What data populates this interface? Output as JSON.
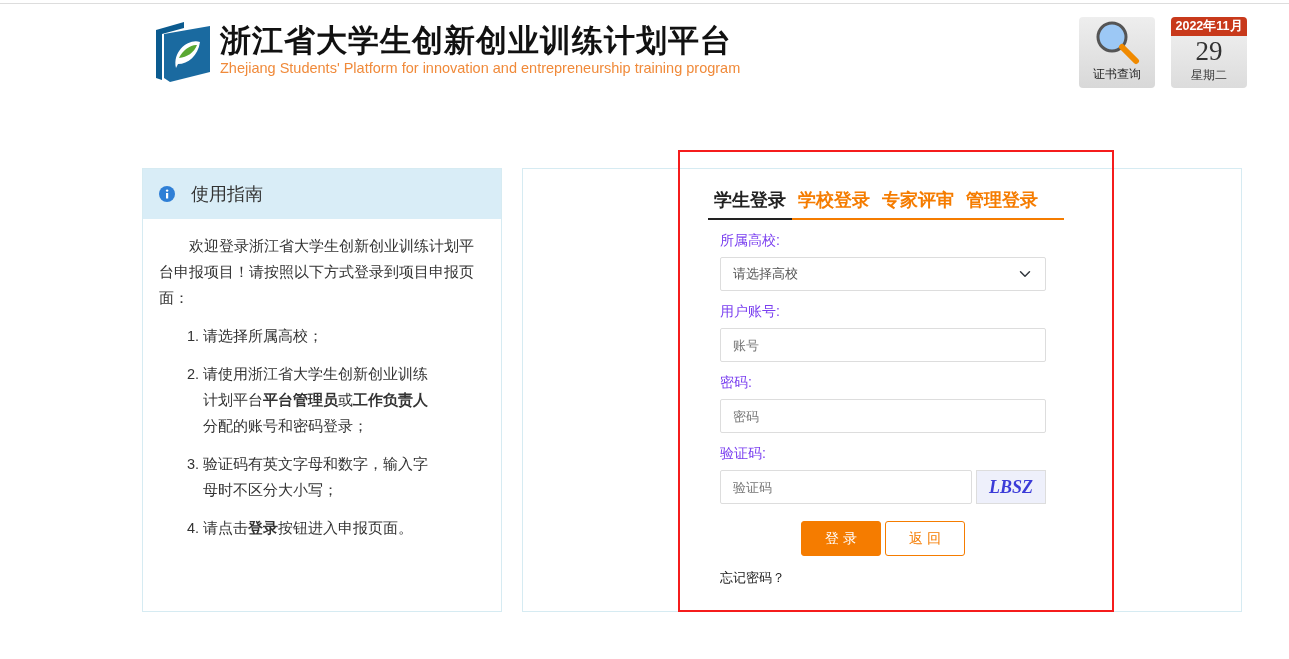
{
  "header": {
    "title": "浙江省大学生创新创业训练计划平台",
    "subtitle": "Zhejiang Students' Platform for innovation and entrepreneurship training program",
    "certificate_button": "证书查询",
    "calendar": {
      "month": "2022年11月",
      "day": "29",
      "weekday": "星期二"
    }
  },
  "guide": {
    "title": "使用指南",
    "intro": "欢迎登录浙江省大学生创新创业训练计划平台申报项目！请按照以下方式登录到项目申报页面：",
    "steps": [
      "1. 请选择所属高校；",
      "2. 请使用浙江省大学生创新创业训练计划平台**平台管理员**或**工作负责人**分配的账号和密码登录；",
      "3. 验证码有英文字母和数字，输入字母时不区分大小写；",
      "4. 请点击**登录**按钮进入申报页面。"
    ]
  },
  "login": {
    "tabs": [
      {
        "label": "学生登录",
        "selected": true
      },
      {
        "label": "学校登录",
        "selected": false
      },
      {
        "label": "专家评审",
        "selected": false
      },
      {
        "label": "管理登录",
        "selected": false
      }
    ],
    "school_label": "所属高校:",
    "school_select": "请选择高校",
    "account_label": "用户账号:",
    "account_placeholder": "账号",
    "password_label": "密码:",
    "password_placeholder": "密码",
    "captcha_label": "验证码:",
    "captcha_placeholder": "验证码",
    "captcha_text": "LBSZ",
    "buttons": [
      "登 录",
      "返 回"
    ],
    "forgot": "忘记密码？"
  }
}
